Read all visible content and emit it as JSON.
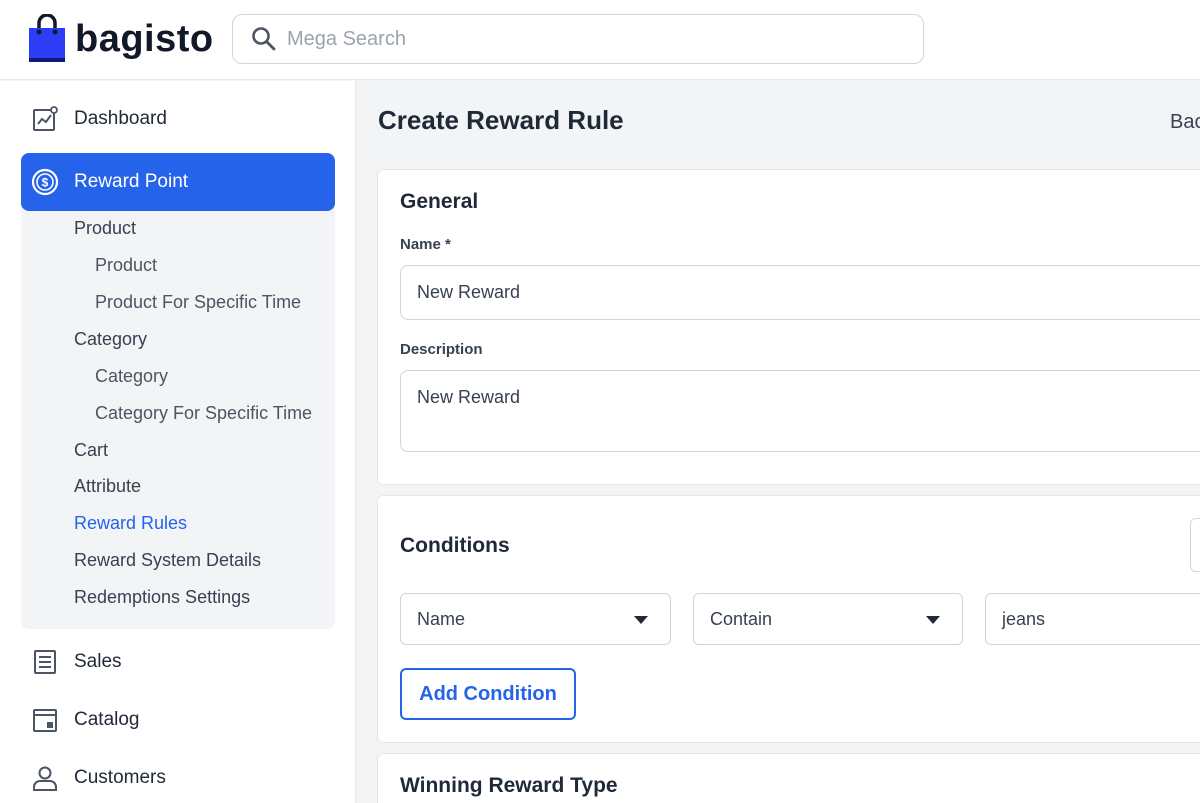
{
  "brand": {
    "name": "bagisto",
    "accent": "#2563eb"
  },
  "search": {
    "placeholder": "Mega Search"
  },
  "sidebar": {
    "dashboard": "Dashboard",
    "reward_point": "Reward Point",
    "subitems": [
      {
        "label": "Product"
      },
      {
        "label": "Product"
      },
      {
        "label": "Product For Specific Time"
      },
      {
        "label": "Category"
      },
      {
        "label": "Category"
      },
      {
        "label": "Category For Specific Time"
      },
      {
        "label": "Cart"
      },
      {
        "label": "Attribute"
      },
      {
        "label": "Reward Rules"
      },
      {
        "label": "Reward System Details"
      },
      {
        "label": "Redemptions Settings"
      }
    ],
    "sales": "Sales",
    "catalog": "Catalog",
    "customers": "Customers"
  },
  "page": {
    "title": "Create Reward Rule",
    "back_label": "Bac"
  },
  "general": {
    "title": "General",
    "name_label": "Name *",
    "name_value": "New Reward",
    "description_label": "Description",
    "description_value": "New Reward"
  },
  "conditions": {
    "title": "Conditions",
    "attribute": "Name",
    "operator": "Contain",
    "value": "jeans",
    "add_button": "Add Condition"
  },
  "winning": {
    "title": "Winning Reward Type"
  },
  "icons": {
    "search": "search-icon",
    "dashboard": "dashboard-icon",
    "reward_point": "dollar-coin-icon",
    "sales": "receipt-icon",
    "catalog": "catalog-icon",
    "customers": "user-icon"
  }
}
